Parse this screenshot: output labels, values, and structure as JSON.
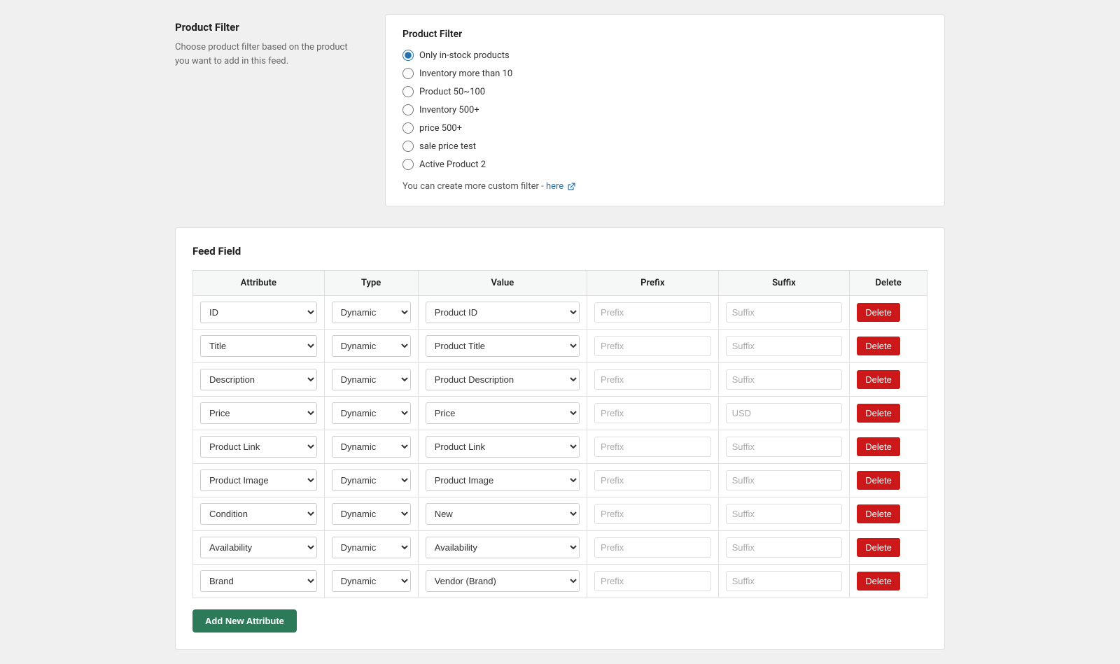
{
  "productFilter": {
    "leftTitle": "Product Filter",
    "leftDescription": "Choose product filter based on the product you want to add in this feed.",
    "rightTitle": "Product Filter",
    "options": [
      {
        "id": "opt1",
        "label": "Only in-stock products",
        "checked": true
      },
      {
        "id": "opt2",
        "label": "Inventory more than 10",
        "checked": false
      },
      {
        "id": "opt3",
        "label": "Product 50~100",
        "checked": false
      },
      {
        "id": "opt4",
        "label": "Inventory 500+",
        "checked": false
      },
      {
        "id": "opt5",
        "label": "price 500+",
        "checked": false
      },
      {
        "id": "opt6",
        "label": "sale price test",
        "checked": false
      },
      {
        "id": "opt7",
        "label": "Active Product 2",
        "checked": false
      }
    ],
    "customFilterText": "You can create more custom filter -",
    "customFilterLink": "here",
    "customFilterHref": "#"
  },
  "feedField": {
    "title": "Feed Field",
    "columns": {
      "attribute": "Attribute",
      "type": "Type",
      "value": "Value",
      "prefix": "Prefix",
      "suffix": "Suffix",
      "delete": "Delete"
    },
    "rows": [
      {
        "attribute": "ID",
        "type": "Dynamic",
        "value": "Product ID",
        "prefix": "",
        "prefixPlaceholder": "Prefix",
        "suffix": "",
        "suffixPlaceholder": "Suffix",
        "deleteLabel": "Delete"
      },
      {
        "attribute": "Title",
        "type": "Dynamic",
        "value": "Product Title",
        "prefix": "",
        "prefixPlaceholder": "Prefix",
        "suffix": "",
        "suffixPlaceholder": "Suffix",
        "deleteLabel": "Delete"
      },
      {
        "attribute": "Description",
        "type": "Dynamic",
        "value": "Product Description",
        "prefix": "",
        "prefixPlaceholder": "Prefix",
        "suffix": "",
        "suffixPlaceholder": "Suffix",
        "deleteLabel": "Delete"
      },
      {
        "attribute": "Price",
        "type": "Dynamic",
        "value": "Price",
        "prefix": "",
        "prefixPlaceholder": "Prefix",
        "suffix": "USD",
        "suffixPlaceholder": "Suffix",
        "deleteLabel": "Delete"
      },
      {
        "attribute": "Product Link",
        "type": "Dynamic",
        "value": "Product Link",
        "prefix": "",
        "prefixPlaceholder": "Prefix",
        "suffix": "",
        "suffixPlaceholder": "Suffix",
        "deleteLabel": "Delete"
      },
      {
        "attribute": "Product Image",
        "type": "Dynamic",
        "value": "Product Image",
        "prefix": "",
        "prefixPlaceholder": "Prefix",
        "suffix": "",
        "suffixPlaceholder": "Suffix",
        "deleteLabel": "Delete"
      },
      {
        "attribute": "Condition",
        "type": "Dynamic",
        "value": "New",
        "prefix": "",
        "prefixPlaceholder": "Prefix",
        "suffix": "",
        "suffixPlaceholder": "Suffix",
        "deleteLabel": "Delete"
      },
      {
        "attribute": "Availability",
        "type": "Dynamic",
        "value": "Availability",
        "prefix": "",
        "prefixPlaceholder": "Prefix",
        "suffix": "",
        "suffixPlaceholder": "Suffix",
        "deleteLabel": "Delete"
      },
      {
        "attribute": "Brand",
        "type": "Dynamic",
        "value": "Vendor (Brand)",
        "prefix": "",
        "prefixPlaceholder": "Prefix",
        "suffix": "",
        "suffixPlaceholder": "Suffix",
        "deleteLabel": "Delete"
      }
    ],
    "addButtonLabel": "Add New Attribute"
  }
}
